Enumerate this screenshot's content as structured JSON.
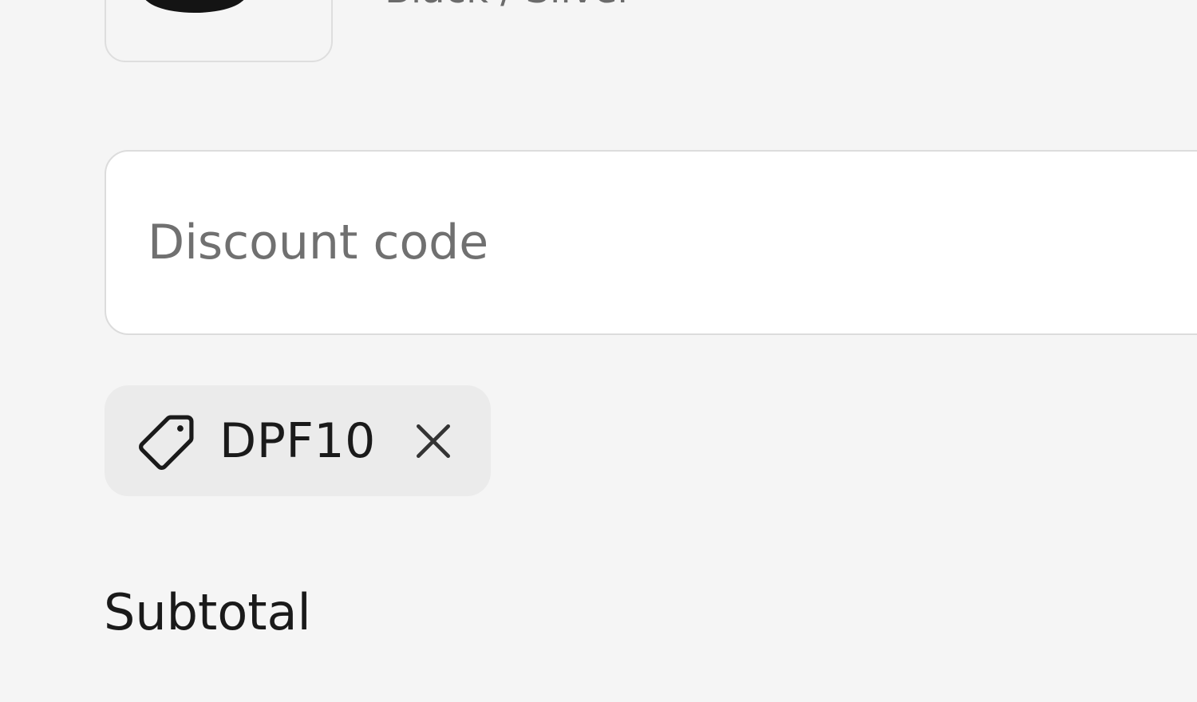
{
  "line_item": {
    "image_icon": "product-image",
    "variant": "Black / Silver"
  },
  "discount": {
    "placeholder": "Discount code",
    "value": "",
    "applied_code": "DPF10",
    "tag_icon": "tag-icon",
    "remove_icon": "close-icon"
  },
  "summary": {
    "subtotal_label": "Subtotal"
  }
}
